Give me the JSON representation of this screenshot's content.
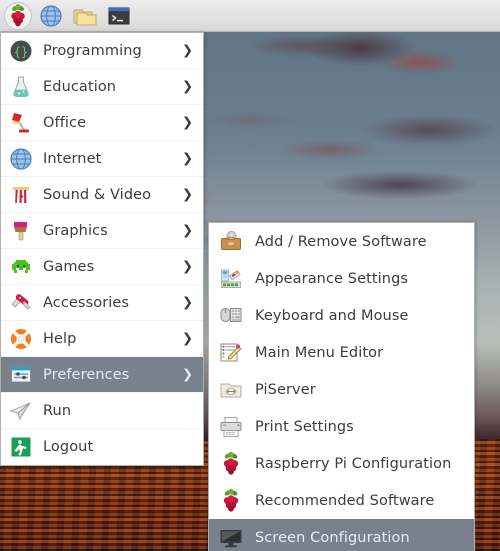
{
  "taskbar": {
    "items": [
      {
        "name": "raspberry-menu-button",
        "icon": "raspberry-icon",
        "label": "Menu"
      },
      {
        "name": "web-browser-button",
        "icon": "globe-icon",
        "label": "Web Browser"
      },
      {
        "name": "file-manager-button",
        "icon": "folder-icon",
        "label": "File Manager"
      },
      {
        "name": "terminal-button",
        "icon": "terminal-icon",
        "label": "Terminal"
      }
    ]
  },
  "main_menu": {
    "items": [
      {
        "label": "Programming",
        "icon": "braces-icon",
        "submenu": true,
        "selected": false
      },
      {
        "label": "Education",
        "icon": "flask-icon",
        "submenu": true,
        "selected": false
      },
      {
        "label": "Office",
        "icon": "desk-lamp-icon",
        "submenu": true,
        "selected": false
      },
      {
        "label": "Internet",
        "icon": "globe-icon",
        "submenu": true,
        "selected": false
      },
      {
        "label": "Sound & Video",
        "icon": "popcorn-icon",
        "submenu": true,
        "selected": false
      },
      {
        "label": "Graphics",
        "icon": "paintbrush-icon",
        "submenu": true,
        "selected": false
      },
      {
        "label": "Games",
        "icon": "space-invader-icon",
        "submenu": true,
        "selected": false
      },
      {
        "label": "Accessories",
        "icon": "swiss-knife-icon",
        "submenu": true,
        "selected": false
      },
      {
        "label": "Help",
        "icon": "lifebuoy-icon",
        "submenu": true,
        "selected": false
      },
      {
        "label": "Preferences",
        "icon": "sliders-icon",
        "submenu": true,
        "selected": true
      },
      {
        "label": "Run",
        "icon": "paper-plane-icon",
        "submenu": false,
        "selected": false
      },
      {
        "label": "Logout",
        "icon": "exit-icon",
        "submenu": false,
        "selected": false
      }
    ],
    "arrow_glyph": "❯"
  },
  "sub_menu": {
    "parent": "Preferences",
    "items": [
      {
        "label": "Add / Remove Software",
        "icon": "software-briefcase-icon",
        "selected": false
      },
      {
        "label": "Appearance Settings",
        "icon": "color-swatch-icon",
        "selected": false
      },
      {
        "label": "Keyboard and Mouse",
        "icon": "keyboard-mouse-icon",
        "selected": false
      },
      {
        "label": "Main Menu Editor",
        "icon": "menu-pencil-icon",
        "selected": false
      },
      {
        "label": "PiServer",
        "icon": "piserver-icon",
        "selected": false
      },
      {
        "label": "Print Settings",
        "icon": "printer-icon",
        "selected": false
      },
      {
        "label": "Raspberry Pi Configuration",
        "icon": "raspberry-icon",
        "selected": false
      },
      {
        "label": "Recommended Software",
        "icon": "raspberry-icon",
        "selected": false
      },
      {
        "label": "Screen Configuration",
        "icon": "monitor-icon",
        "selected": true
      }
    ]
  },
  "colors": {
    "highlight": "#79828c",
    "menu_background": "#ffffff",
    "menu_text": "#3c3c3c",
    "highlight_text": "#e8ebee",
    "taskbar_background": "#e2e2e2"
  },
  "desktop": {
    "wallpaper_description": "Sunset over water with orange clouds"
  }
}
